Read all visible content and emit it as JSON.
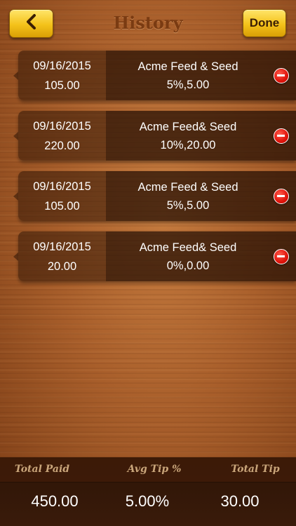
{
  "header": {
    "title": "History",
    "back_icon": "chevron-left-icon",
    "done_label": "Done"
  },
  "history": [
    {
      "date": "09/16/2015",
      "amount": "105.00",
      "merchant": "Acme Feed & Seed",
      "tip": "5%,5.00"
    },
    {
      "date": "09/16/2015",
      "amount": "220.00",
      "merchant": "Acme Feed& Seed",
      "tip": "10%,20.00"
    },
    {
      "date": "09/16/2015",
      "amount": "105.00",
      "merchant": "Acme Feed & Seed",
      "tip": "5%,5.00"
    },
    {
      "date": "09/16/2015",
      "amount": "20.00",
      "merchant": "Acme Feed& Seed",
      "tip": "0%,0.00"
    }
  ],
  "footer": {
    "total_paid_label": "Total Paid",
    "avg_tip_label": "Avg Tip %",
    "total_tip_label": "Total Tip",
    "total_paid": "450.00",
    "avg_tip": "5.00%",
    "total_tip": "30.00"
  },
  "colors": {
    "button_gold": "#f4c21a",
    "title_brown": "#7a3b12",
    "delete_red": "#e0130a"
  }
}
